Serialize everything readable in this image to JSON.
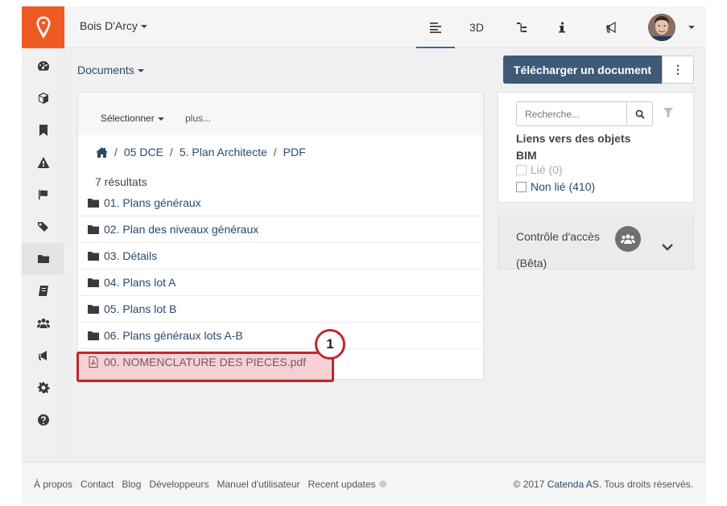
{
  "topbar": {
    "project": "Bois D'Arcy",
    "tabs": [
      {
        "label": "",
        "icon": "list-icon",
        "active": true
      },
      {
        "label": "3D",
        "icon": "",
        "active": false
      },
      {
        "label": "",
        "icon": "tree-icon",
        "active": false
      },
      {
        "label": "",
        "icon": "info-icon",
        "active": false
      },
      {
        "label": "",
        "icon": "megaphone-icon",
        "active": false
      }
    ]
  },
  "sidebar": {
    "items": [
      {
        "icon": "dashboard-icon"
      },
      {
        "icon": "cube-icon"
      },
      {
        "icon": "bookmark-icon"
      },
      {
        "icon": "warning-icon"
      },
      {
        "icon": "flag-icon"
      },
      {
        "icon": "tags-icon"
      },
      {
        "icon": "folder-icon",
        "active": true
      },
      {
        "icon": "book-icon"
      },
      {
        "icon": "users-icon"
      },
      {
        "icon": "megaphone-icon"
      },
      {
        "icon": "gear-icon"
      },
      {
        "icon": "help-icon"
      }
    ]
  },
  "main": {
    "documents_label": "Documents",
    "upload_label": "Télécharger un document",
    "more_label": "⋮",
    "toolbar": {
      "select_label": "Sélectionner",
      "more_label": "plus..."
    },
    "breadcrumb": [
      "05 DCE",
      "5. Plan Architecte",
      "PDF"
    ],
    "breadcrumb_sep": "/",
    "result_count": "7 résultats",
    "files": [
      {
        "name": "01. Plans généraux",
        "type": "folder"
      },
      {
        "name": "02. Plan des niveaux généraux",
        "type": "folder"
      },
      {
        "name": "03. Détails",
        "type": "folder"
      },
      {
        "name": "04. Plans lot A",
        "type": "folder"
      },
      {
        "name": "05. Plans lot B",
        "type": "folder"
      },
      {
        "name": "06. Plans généraux lots A-B",
        "type": "folder"
      },
      {
        "name": "00. NOMENCLATURE DES PIECES.pdf",
        "type": "pdf"
      }
    ],
    "annotation_number": "1"
  },
  "filter": {
    "search_placeholder": "Recherche...",
    "bim_title": "Liens vers des objets BIM",
    "options": [
      {
        "label": "Lié (0)",
        "enabled": false
      },
      {
        "label": "Non lié (410)",
        "enabled": true
      }
    ]
  },
  "access": {
    "label": "Contrôle d'accès",
    "beta": "(Bêta)"
  },
  "footer": {
    "links": [
      "À propos",
      "Contact",
      "Blog",
      "Développeurs",
      "Manuel d'utilisateur",
      "Recent updates"
    ],
    "copyright_prefix": "© 2017",
    "copyright_company": "Catenda AS.",
    "copyright_suffix": "Tous droits réservés."
  },
  "colors": {
    "brand": "#ee5a24",
    "primary_button": "#3f5a78",
    "highlight": "#c0262d"
  }
}
